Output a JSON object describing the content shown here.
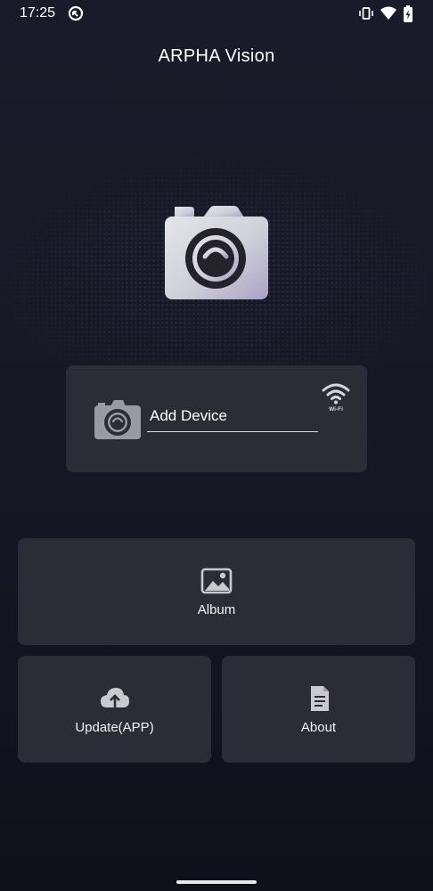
{
  "status_bar": {
    "time": "17:25",
    "icons": [
      "sync-icon",
      "vibrate-icon",
      "wifi-signal-icon",
      "battery-charging-icon"
    ]
  },
  "header": {
    "title": "ARPHA Vision"
  },
  "hero": {
    "icon": "camera-icon"
  },
  "add_device": {
    "label": "Add Device",
    "camera_icon": "camera-icon",
    "wifi_badge": "Wi-Fi"
  },
  "tiles": {
    "album": {
      "label": "Album",
      "icon": "image-icon"
    },
    "update": {
      "label": "Update(APP)",
      "icon": "cloud-upload-icon"
    },
    "about": {
      "label": "About",
      "icon": "document-icon"
    }
  },
  "colors": {
    "background": "#181927",
    "card": "#2b2c36",
    "icon_gray": "#c9c9cf",
    "text": "#ffffff"
  }
}
